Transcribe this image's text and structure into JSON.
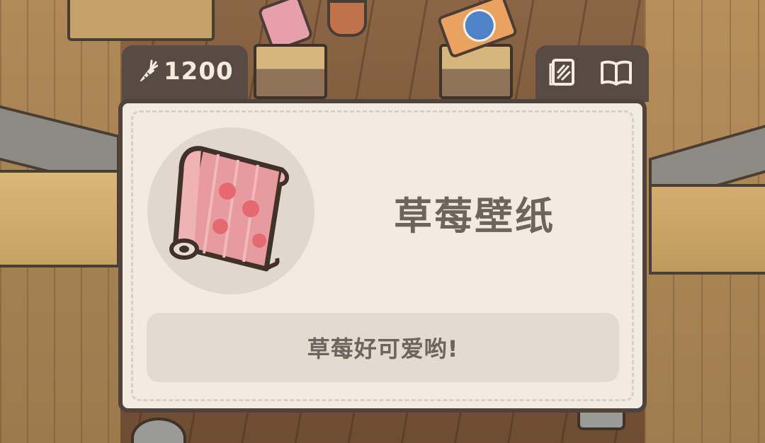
{
  "header": {
    "currency": {
      "icon": "carrot-icon",
      "value": "1200"
    },
    "buttons": [
      {
        "icon": "wallpaper-icon"
      },
      {
        "icon": "book-icon"
      }
    ]
  },
  "item_card": {
    "image_icon": "strawberry-wallpaper-roll",
    "name": "草莓壁纸",
    "description": "草莓好可爱哟!"
  },
  "colors": {
    "card_bg": "#f1ecdf",
    "card_border": "#4f433c",
    "tab_bg": "#574b44",
    "text": "#6c645d",
    "wallpaper_pink": "#e89b9f"
  }
}
